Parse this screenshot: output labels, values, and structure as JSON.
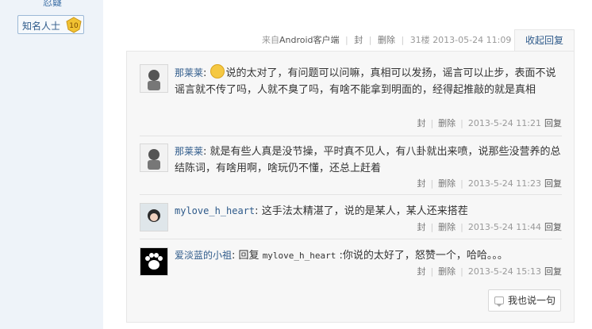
{
  "left": {
    "top_text": "忍嶷",
    "rank_label": "知名人士",
    "rank_level": "10"
  },
  "post": {
    "meta_prefix": "来自",
    "client": "Android客户端",
    "action_block": "封",
    "action_delete": "删除",
    "floor": "31楼",
    "time": "2013-05-24 11:09",
    "collapse_label": "收起回复"
  },
  "replies": [
    {
      "user": "那莱莱",
      "has_emoji": true,
      "text": "说的太对了，有问题可以问嘛，真相可以发扬，谣言可以止步，表面不说谣言就不传了吗，人就不臭了吗，有啥不能拿到明面的，经得起推敲的就是真相",
      "block": "封",
      "delete": "删除",
      "time": "2013-5-24 11:21",
      "reply": "回复"
    },
    {
      "user": "那莱莱",
      "text": "就是有些人真是没节操，平时真不见人，有八卦就出来喷，说那些没营养的总结陈词，有啥用啊，啥玩仍不懂，还总上赶着",
      "block": "封",
      "delete": "删除",
      "time": "2013-5-24 11:23",
      "reply": "回复"
    },
    {
      "user": "mylove_h_heart",
      "text": "这手法太精湛了，说的是某人，某人还来搭茬",
      "block": "封",
      "delete": "删除",
      "time": "2013-5-24 11:44",
      "reply": "回复"
    },
    {
      "user": "爱淡蓝的小祖",
      "text_prefix": "回复 ",
      "text_mention": "mylove_h_heart",
      "text": " :你说的太好了，怒赞一个，哈哈。。。",
      "block": "封",
      "delete": "删除",
      "time": "2013-5-24 15:13",
      "reply": "回复"
    }
  ],
  "say_button": "我也说一句",
  "colors": {
    "link": "#2e5a8a",
    "meta": "#999999",
    "box_bg": "#f7f7f7",
    "left_bg": "#eef3f9"
  }
}
